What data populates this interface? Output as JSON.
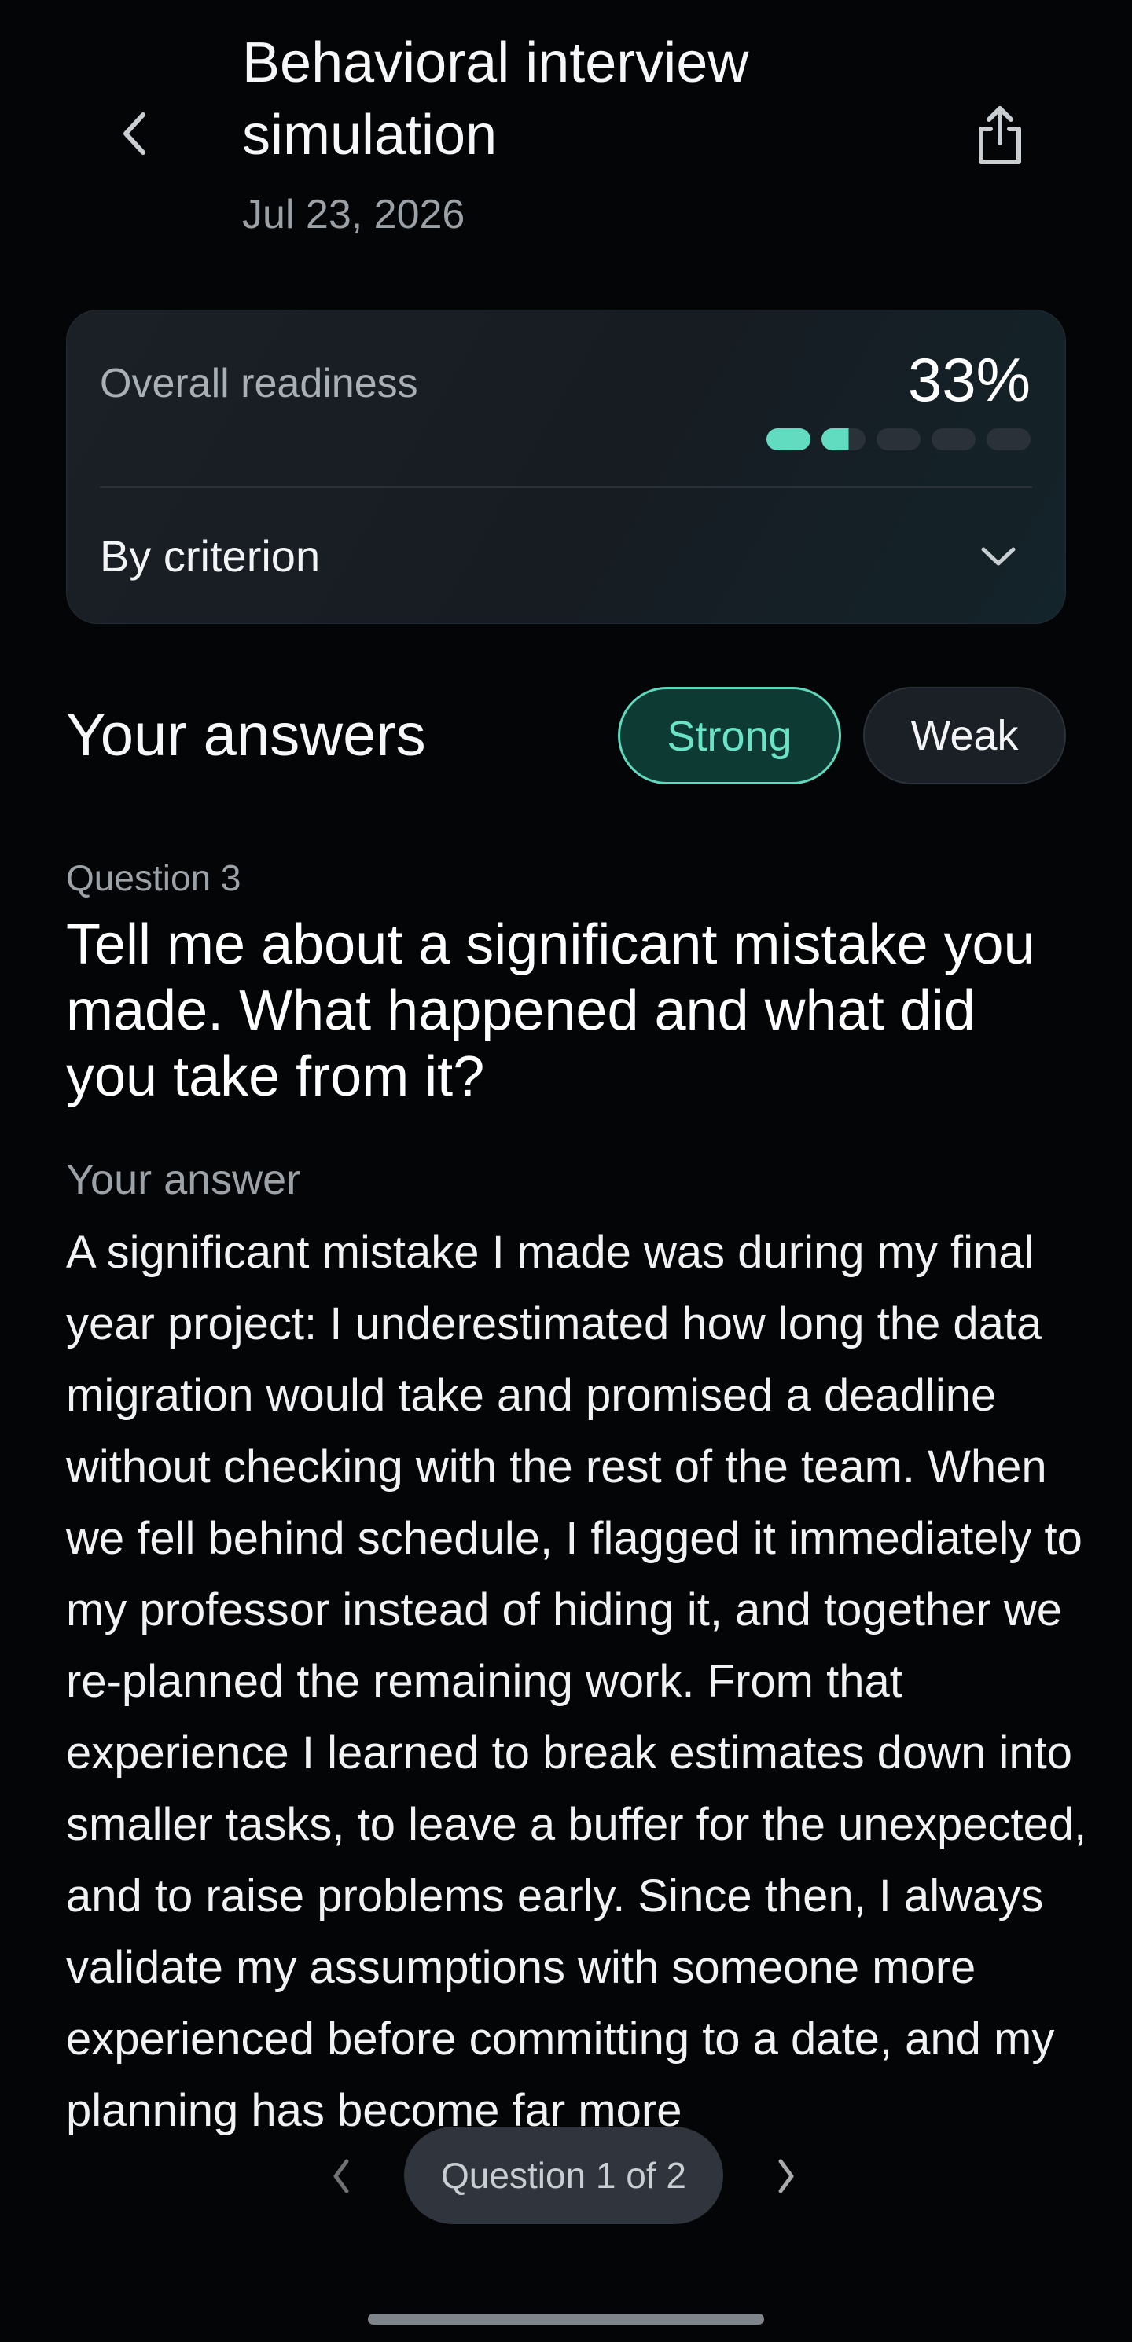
{
  "header": {
    "title": "Behavioral interview simulation",
    "date": "Jul 23, 2026"
  },
  "readiness": {
    "label": "Overall readiness",
    "value": "33%",
    "progress_fraction": 0.33,
    "criterion_label": "By criterion"
  },
  "answers": {
    "title": "Your answers",
    "filters": [
      {
        "label": "Strong",
        "selected": true
      },
      {
        "label": "Weak",
        "selected": false
      }
    ]
  },
  "question": {
    "number_label": "Question 3",
    "text": "Tell me about a significant mistake you made. What happened and what did you take from it?",
    "answer_label": "Your answer",
    "answer_text": "A significant mistake I made was during my final year project: I underestimated how long the data migration would take and promised a deadline without checking with the rest of the team. When we fell behind schedule, I flagged it immediately to my professor instead of hiding it, and together we re-planned the remaining work. From that experience I learned to break estimates down into smaller tasks, to leave a buffer for the unexpected, and to raise problems early. Since then, I always validate my assumptions with someone more experienced before committing to a date, and my planning has become far more"
  },
  "pager": {
    "label": "Question 1 of 2"
  },
  "colors": {
    "accent": "#62dcc0",
    "background": "#040506",
    "card": "#1b2027"
  },
  "icons": {
    "back": "chevron-left-icon",
    "share": "share-icon",
    "expand": "chevron-down-icon",
    "prev": "chevron-left-icon",
    "next": "chevron-right-icon"
  }
}
